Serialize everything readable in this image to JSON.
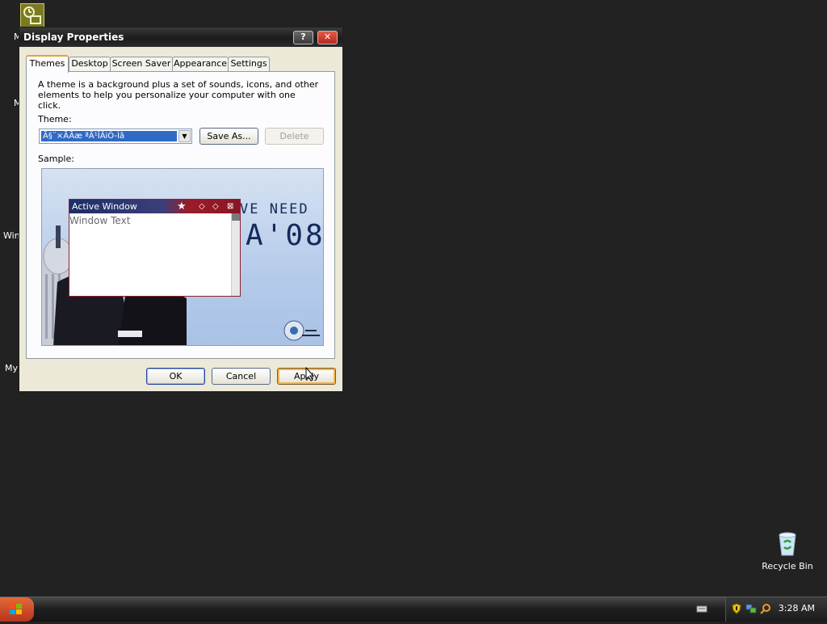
{
  "desktop": {
    "partial_labels": [
      "M",
      "M",
      "Win",
      "My"
    ],
    "recycle_bin_label": "Recycle Bin"
  },
  "dialog": {
    "title": "Display Properties",
    "help_label": "?",
    "close_label": "✕",
    "tabs": [
      {
        "label": "Themes",
        "active": true
      },
      {
        "label": "Desktop",
        "active": false
      },
      {
        "label": "Screen Saver",
        "active": false
      },
      {
        "label": "Appearance",
        "active": false
      },
      {
        "label": "Settings",
        "active": false
      }
    ],
    "description": "A theme is a background plus a set of sounds, icons, and other elements to help you personalize your computer with one click.",
    "theme_label": "Theme:",
    "theme_value": "Ã§¨×ÃÃæ ªÃ¹ÎÂiÔ-Ìâ",
    "save_as_label": "Save As...",
    "delete_label": "Delete",
    "sample_label": "Sample:",
    "sample": {
      "window_title": "Active Window",
      "window_text": "Window Text",
      "poster_line1": "VE NEED",
      "poster_line2": "A'08"
    },
    "ok_label": "OK",
    "cancel_label": "Cancel",
    "apply_label": "Apply"
  },
  "taskbar": {
    "clock": "3:28 AM"
  },
  "colors": {
    "selection": "#316ac5",
    "active_tab_accent": "#e6a23a",
    "close_button": "#c8382a"
  }
}
